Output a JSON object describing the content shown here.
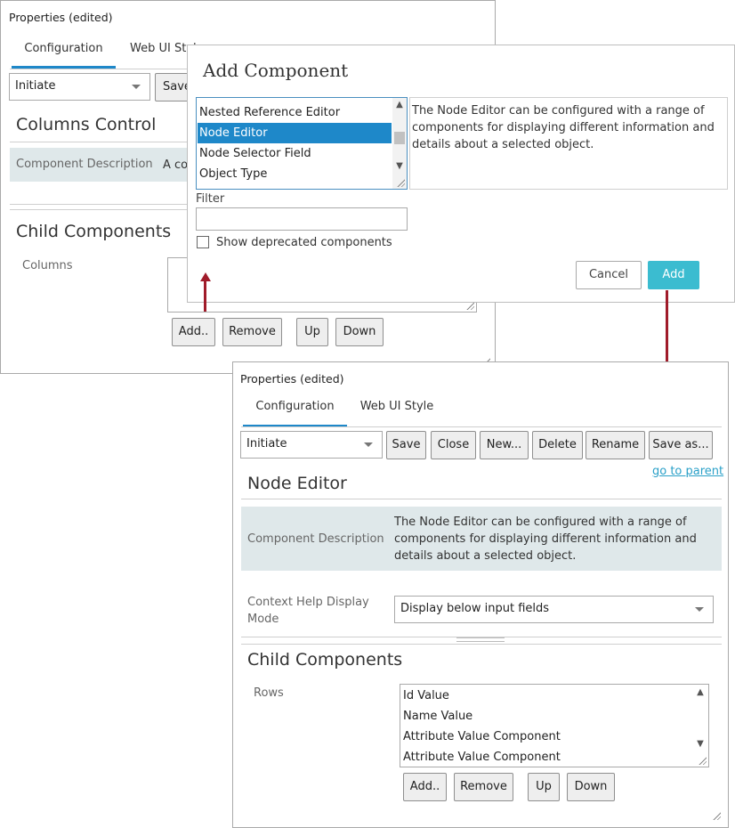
{
  "back_panel": {
    "title": "Properties (edited)",
    "tabs": [
      {
        "label": "Configuration"
      },
      {
        "label": "Web UI Style"
      }
    ],
    "select_value": "Initiate",
    "save_partial": "Save",
    "section_title": "Columns Control",
    "desc_label": "Component Description",
    "desc_partial": "A co",
    "child_title": "Child Components",
    "columns_label": "Columns",
    "buttons": {
      "add": "Add..",
      "remove": "Remove",
      "up": "Up",
      "down": "Down"
    }
  },
  "dialog": {
    "title": "Add Component",
    "list_items": [
      "Nested Reference Editor",
      "Node Editor",
      "Node Selector Field",
      "Object Type"
    ],
    "selected_index": 1,
    "description": "The Node Editor can be configured with a range of components for displaying different information and details about a selected object.",
    "filter_label": "Filter",
    "filter_value": "",
    "deprecated_label": "Show deprecated components",
    "cancel": "Cancel",
    "add": "Add"
  },
  "front_panel": {
    "title": "Properties (edited)",
    "tabs": [
      {
        "label": "Configuration"
      },
      {
        "label": "Web UI Style"
      }
    ],
    "select_value": "Initiate",
    "toolbar": {
      "save": "Save",
      "close": "Close",
      "new": "New...",
      "delete": "Delete",
      "rename": "Rename",
      "save_as": "Save as..."
    },
    "parent_link": "go to parent",
    "section_title": "Node Editor",
    "desc_label": "Component Description",
    "description": "The Node Editor can be configured with a range of components for displaying different information and details about a selected object.",
    "help_label": "Context Help Display Mode",
    "help_value": "Display below input fields",
    "child_title": "Child Components",
    "rows_label": "Rows",
    "rows": [
      "Id Value",
      "Name Value",
      "Attribute Value Component",
      "Attribute Value Component"
    ],
    "buttons": {
      "add": "Add..",
      "remove": "Remove",
      "up": "Up",
      "down": "Down"
    }
  },
  "colors": {
    "accent": "#1e88c9",
    "add_button": "#3bbcd0",
    "arrow": "#a01c2a",
    "desc_bg": "#dfe8ea",
    "link": "#2aa0c8"
  }
}
